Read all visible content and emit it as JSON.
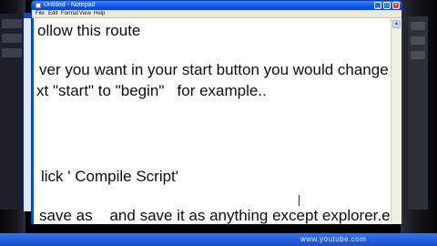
{
  "window": {
    "title": "Untitled - Notepad",
    "controls": {
      "minimize": "_",
      "maximize": "□",
      "close": "×"
    }
  },
  "menu": [
    "File",
    "Edit",
    "Format",
    "View",
    "Help"
  ],
  "editor": {
    "lines": [
      "ollow this route",
      "ver you want in your start button you would change",
      "xt \"start\" to \"begin\"   for example..",
      "lick ' Compile Script'",
      "save as    and save it as anything except explorer.exe"
    ]
  },
  "scrollbar": {
    "up_arrow": "▲"
  },
  "taskbar": {
    "label": "www.youtube.com"
  }
}
